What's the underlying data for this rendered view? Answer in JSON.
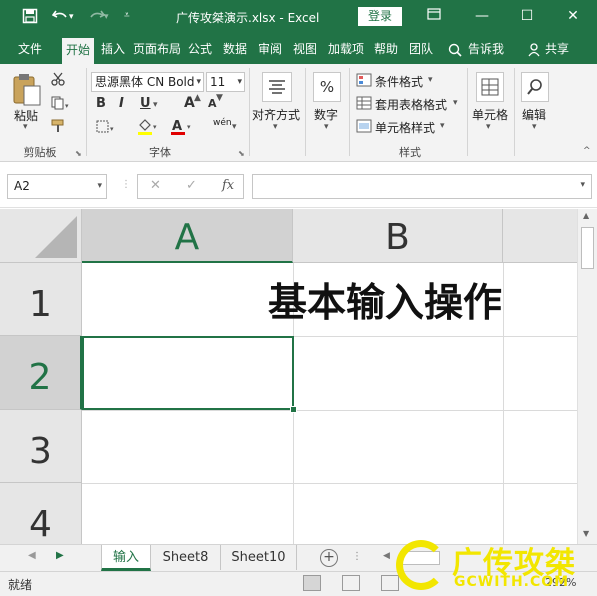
{
  "titlebar": {
    "save_icon": "save-icon",
    "undo_icon": "undo-icon",
    "redo_icon": "redo-icon",
    "customize_icon": "customize-icon",
    "title": "广传攻桀演示.xlsx  -  Excel",
    "login": "登录",
    "restore_ribbon_icon": "ribbon-display-icon",
    "minimize": "—",
    "maximize": "☐",
    "close": "✕"
  },
  "tabs": [
    "文件",
    "开始",
    "插入",
    "页面布局",
    "公式",
    "数据",
    "审阅",
    "视图",
    "加载项",
    "帮助",
    "团队"
  ],
  "active_tab": "开始",
  "tell_me": "告诉我",
  "share": "共享",
  "ribbon": {
    "clipboard": {
      "paste": "粘贴",
      "label": "剪贴板"
    },
    "font": {
      "name": "思源黑体 CN Bold",
      "size": "11",
      "bold": "B",
      "italic": "I",
      "underline": "U",
      "grow": "A",
      "shrink": "A",
      "fill_icon": "fill-color-icon",
      "font_color_icon": "font-color-icon",
      "phonetic": "wén",
      "label": "字体"
    },
    "alignment": {
      "label": "对齐方式"
    },
    "number": {
      "symbol": "%",
      "label": "数字"
    },
    "styles": {
      "conditional": "条件格式",
      "table": "套用表格格式",
      "cell": "单元格样式",
      "label": "样式"
    },
    "cells": {
      "label": "单元格"
    },
    "editing": {
      "label": "编辑"
    }
  },
  "formula_bar": {
    "namebox": "A2",
    "cancel": "✕",
    "enter": "✓",
    "fx": "fx",
    "value": ""
  },
  "grid": {
    "columns": [
      "A",
      "B"
    ],
    "rows": [
      "1",
      "2",
      "3",
      "4"
    ],
    "title_text": "基本输入操作",
    "active_cell": "A2"
  },
  "sheets": [
    "输入",
    "Sheet8",
    "Sheet10"
  ],
  "active_sheet": "输入",
  "status": "就绪",
  "zoom": "292%",
  "watermark": {
    "cn": "广传攻桀",
    "en": "GCWITH.COM"
  },
  "colors": {
    "accent": "#217346",
    "watermark": "#f2e600"
  }
}
